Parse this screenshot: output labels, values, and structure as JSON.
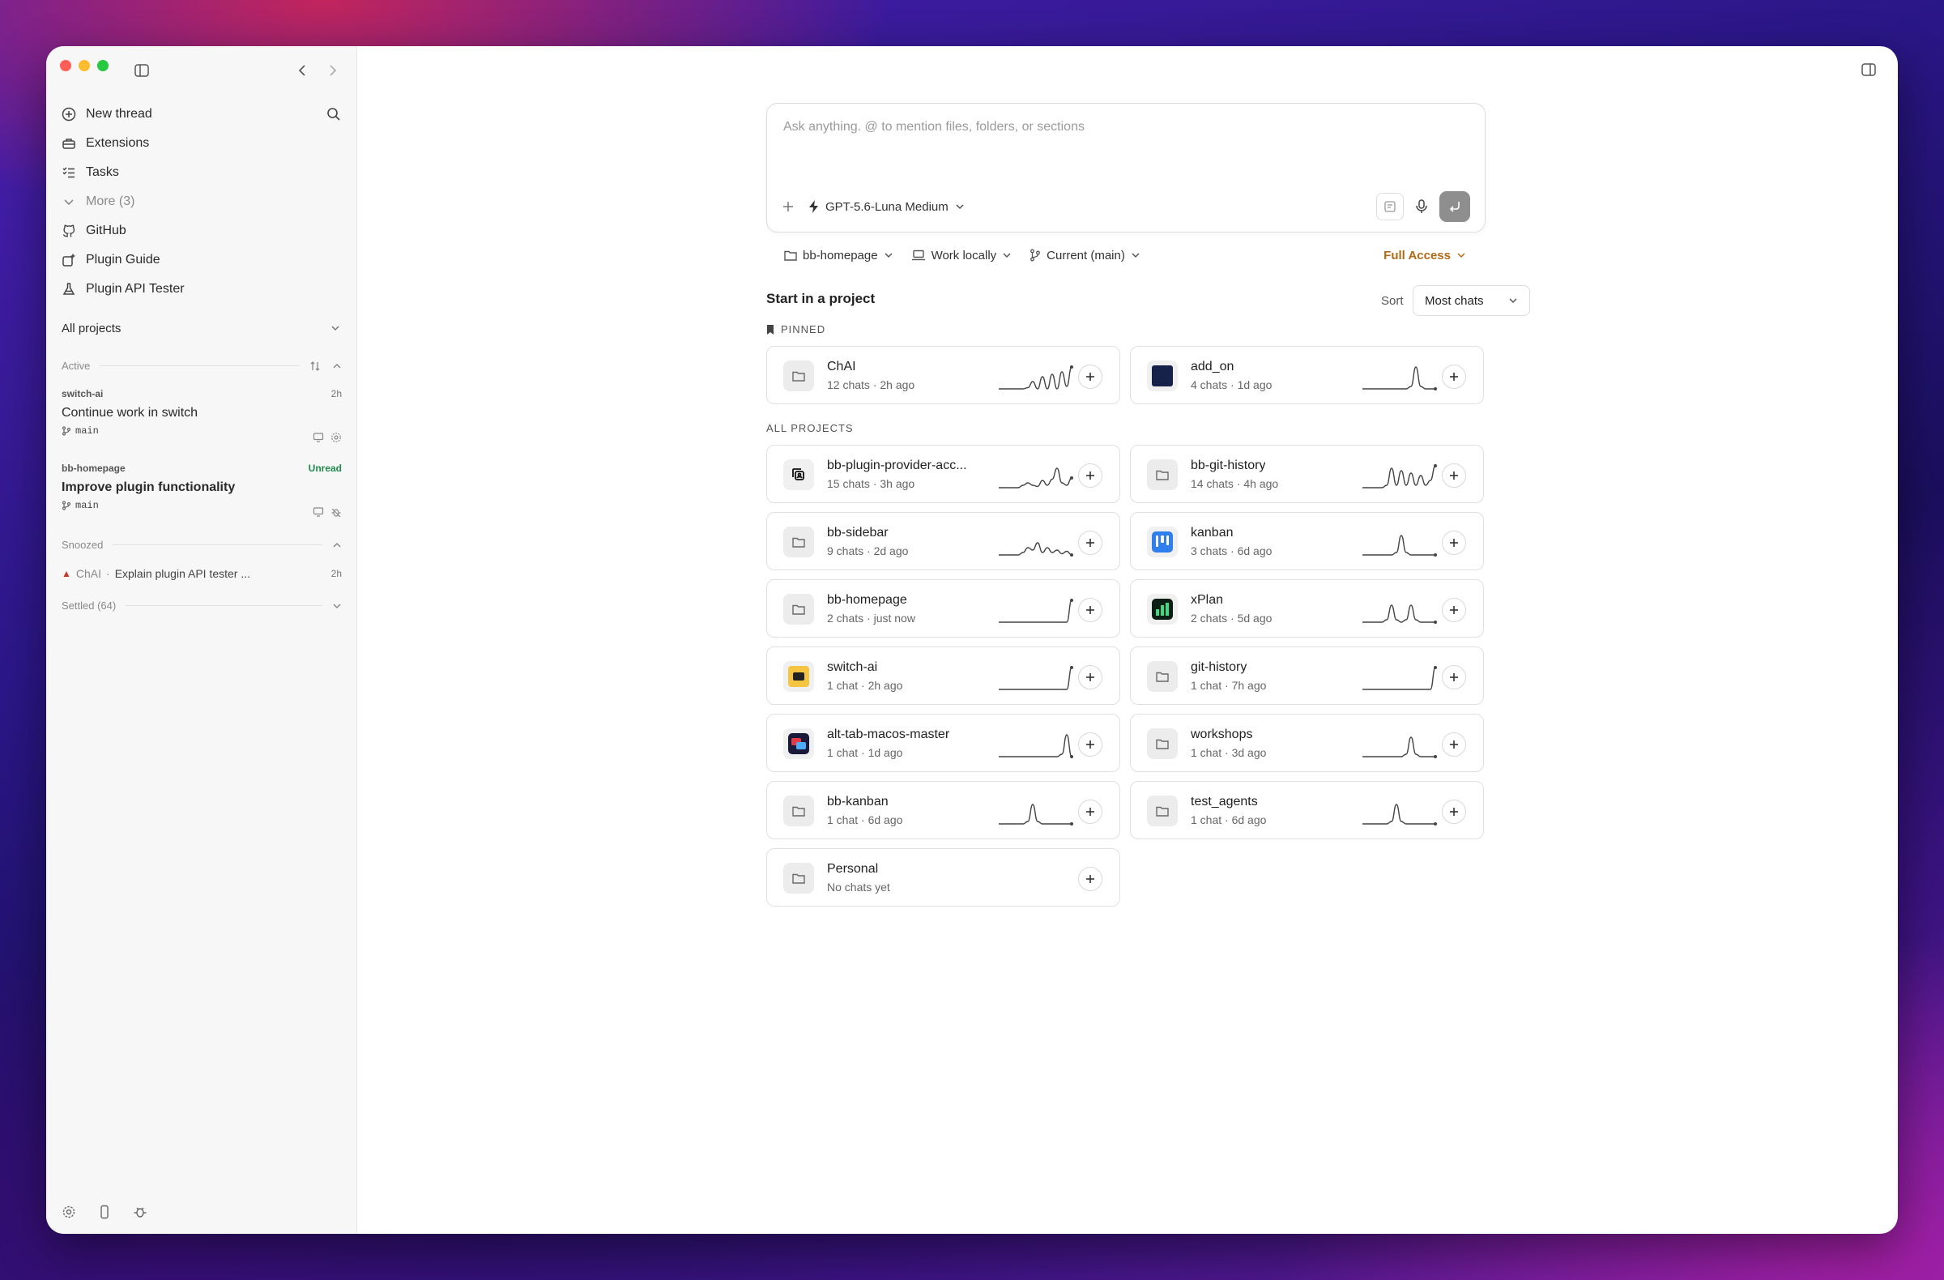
{
  "sidebar": {
    "nav": [
      {
        "label": "New thread",
        "icon": "plus-circle-icon"
      },
      {
        "label": "Extensions",
        "icon": "toolbox-icon"
      },
      {
        "label": "Tasks",
        "icon": "checklist-icon"
      },
      {
        "label": "More (3)",
        "icon": "chevron-down-icon"
      },
      {
        "label": "GitHub",
        "icon": "github-icon"
      },
      {
        "label": "Plugin Guide",
        "icon": "plugin-icon"
      },
      {
        "label": "Plugin API Tester",
        "icon": "flask-icon"
      }
    ],
    "all_projects": "All projects",
    "active_label": "Active",
    "threads": [
      {
        "project": "switch-ai",
        "title": "Continue work in switch",
        "branch": "main",
        "time": "2h"
      },
      {
        "project": "bb-homepage",
        "title": "Improve plugin functionality",
        "branch": "main",
        "status": "Unread"
      }
    ],
    "snoozed_label": "Snoozed",
    "snoozed_item": {
      "project": "ChAI",
      "sep": "·",
      "title": "Explain plugin API tester ...",
      "time": "2h"
    },
    "settled_label": "Settled (64)"
  },
  "composer": {
    "placeholder": "Ask anything. @ to mention files, folders, or sections",
    "model": "GPT-5.6-Luna Medium"
  },
  "context": {
    "project": "bb-homepage",
    "location": "Work locally",
    "branch": "Current (main)",
    "access": "Full Access"
  },
  "projects_section": {
    "title": "Start in a project",
    "sort_label": "Sort",
    "sort_value": "Most chats",
    "pinned_label": "PINNED",
    "all_label": "ALL PROJECTS"
  },
  "pinned": [
    {
      "name": "ChAI",
      "meta": "12 chats · 2h ago",
      "icon": "folder-icon",
      "spark": [
        0,
        0,
        0,
        0,
        0,
        0,
        0.05,
        0.3,
        0,
        0.5,
        0,
        0.6,
        0,
        0.7,
        0.1,
        0.9
      ]
    },
    {
      "name": "add_on",
      "meta": "4 chats · 1d ago",
      "icon": "app-logo-icon",
      "spark": [
        0,
        0,
        0,
        0,
        0,
        0,
        0,
        0,
        0,
        0,
        0.1,
        0.9,
        0.1,
        0,
        0,
        0
      ]
    }
  ],
  "projects": [
    {
      "name": "bb-plugin-provider-acc...",
      "meta": "15 chats · 3h ago",
      "icon": "plugin-logo-icon",
      "spark": [
        0,
        0,
        0,
        0,
        0,
        0.1,
        0.2,
        0.1,
        0.05,
        0.3,
        0.1,
        0.35,
        0.8,
        0.2,
        0.1,
        0.4
      ]
    },
    {
      "name": "bb-git-history",
      "meta": "14 chats · 4h ago",
      "icon": "folder-icon",
      "spark": [
        0,
        0,
        0,
        0,
        0,
        0.1,
        0.8,
        0.1,
        0.7,
        0.1,
        0.6,
        0.1,
        0.5,
        0.1,
        0.3,
        0.9
      ]
    },
    {
      "name": "bb-sidebar",
      "meta": "9 chats · 2d ago",
      "icon": "folder-icon",
      "spark": [
        0,
        0,
        0,
        0,
        0,
        0.1,
        0.3,
        0.2,
        0.5,
        0.1,
        0.3,
        0.1,
        0.2,
        0.05,
        0.15,
        0
      ]
    },
    {
      "name": "kanban",
      "meta": "3 chats · 6d ago",
      "icon": "kanban-logo-icon",
      "spark": [
        0,
        0,
        0,
        0,
        0,
        0,
        0,
        0.1,
        0.8,
        0.1,
        0,
        0,
        0,
        0,
        0,
        0
      ]
    },
    {
      "name": "bb-homepage",
      "meta": "2 chats · just now",
      "icon": "folder-icon",
      "spark": [
        0,
        0,
        0,
        0,
        0,
        0,
        0,
        0,
        0,
        0,
        0,
        0,
        0,
        0,
        0,
        0.9
      ]
    },
    {
      "name": "xPlan",
      "meta": "2 chats · 5d ago",
      "icon": "xplan-logo-icon",
      "spark": [
        0,
        0,
        0,
        0,
        0,
        0.1,
        0.7,
        0.1,
        0,
        0.1,
        0.7,
        0.1,
        0,
        0,
        0,
        0
      ]
    },
    {
      "name": "switch-ai",
      "meta": "1 chat · 2h ago",
      "icon": "switch-logo-icon",
      "spark": [
        0,
        0,
        0,
        0,
        0,
        0,
        0,
        0,
        0,
        0,
        0,
        0,
        0,
        0,
        0,
        0.9
      ]
    },
    {
      "name": "git-history",
      "meta": "1 chat · 7h ago",
      "icon": "folder-icon",
      "spark": [
        0,
        0,
        0,
        0,
        0,
        0,
        0,
        0,
        0,
        0,
        0,
        0,
        0,
        0,
        0,
        0.9
      ]
    },
    {
      "name": "alt-tab-macos-master",
      "meta": "1 chat · 1d ago",
      "icon": "alttab-logo-icon",
      "spark": [
        0,
        0,
        0,
        0,
        0,
        0,
        0,
        0,
        0,
        0,
        0,
        0,
        0,
        0.1,
        0.9,
        0
      ]
    },
    {
      "name": "workshops",
      "meta": "1 chat · 3d ago",
      "icon": "folder-icon",
      "spark": [
        0,
        0,
        0,
        0,
        0,
        0,
        0,
        0,
        0,
        0.1,
        0.8,
        0.1,
        0,
        0,
        0,
        0
      ]
    },
    {
      "name": "bb-kanban",
      "meta": "1 chat · 6d ago",
      "icon": "folder-icon",
      "spark": [
        0,
        0,
        0,
        0,
        0,
        0,
        0.1,
        0.8,
        0.1,
        0,
        0,
        0,
        0,
        0,
        0,
        0
      ]
    },
    {
      "name": "test_agents",
      "meta": "1 chat · 6d ago",
      "icon": "folder-icon",
      "spark": [
        0,
        0,
        0,
        0,
        0,
        0,
        0.1,
        0.8,
        0.1,
        0,
        0,
        0,
        0,
        0,
        0,
        0
      ]
    },
    {
      "name": "Personal",
      "meta": "No chats yet",
      "icon": "folder-icon",
      "spark": null
    }
  ]
}
